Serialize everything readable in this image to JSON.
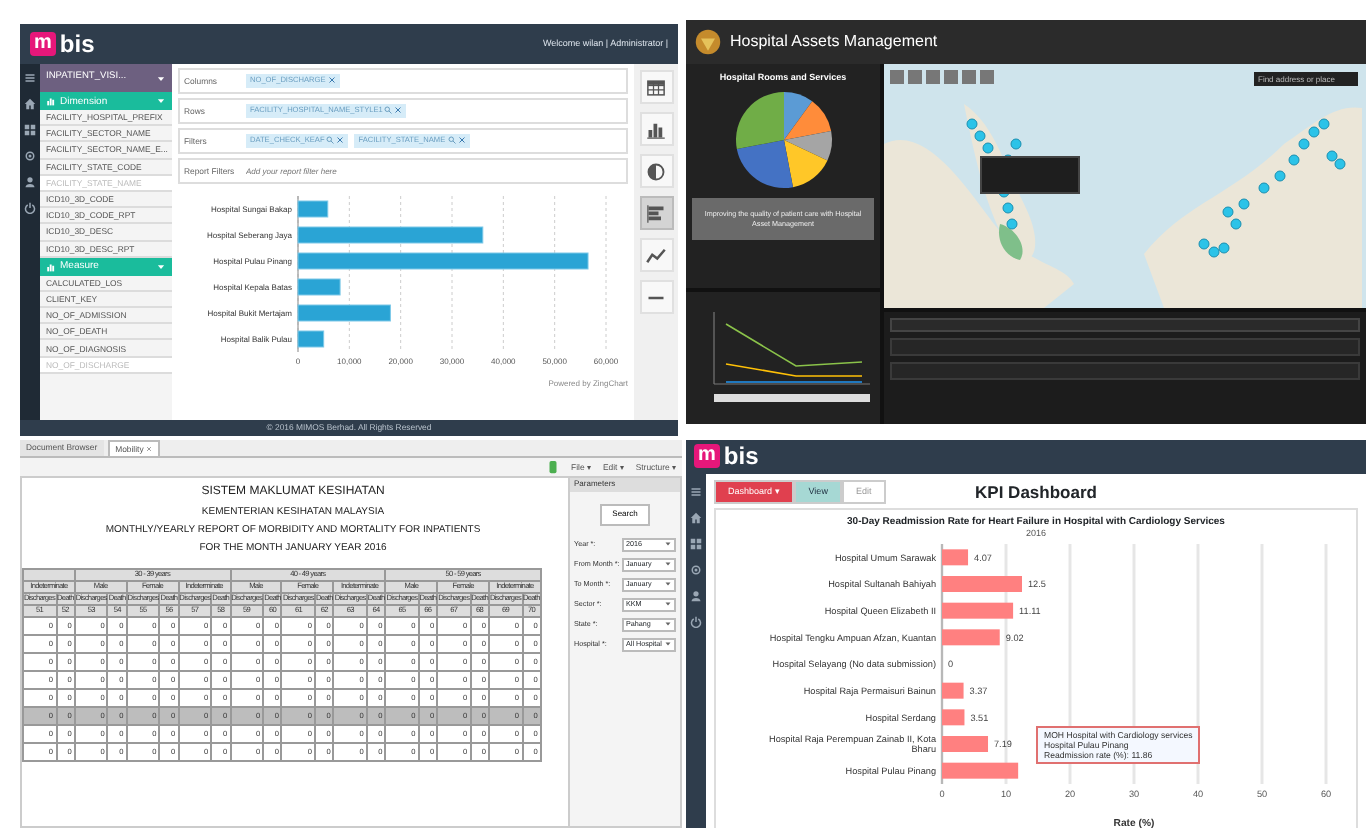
{
  "dashboard_builder": {
    "logo": {
      "mark": "m",
      "text": "bis"
    },
    "welcome": "Welcome wilan | Administrator |",
    "cube_select": "INPATIENT_VISI...",
    "field_groups": [
      {
        "title": "Dimension",
        "expanded": true,
        "fields": [
          {
            "label": "FACILITY_HOSPITAL_PREFIX",
            "disabled": false
          },
          {
            "label": "FACILITY_SECTOR_NAME",
            "disabled": false
          },
          {
            "label": "FACILITY_SECTOR_NAME_E...",
            "disabled": false
          },
          {
            "label": "FACILITY_STATE_CODE",
            "disabled": false
          },
          {
            "label": "FACILITY_STATE_NAME",
            "disabled": true
          },
          {
            "label": "ICD10_3D_CODE",
            "disabled": false
          },
          {
            "label": "ICD10_3D_CODE_RPT",
            "disabled": false
          },
          {
            "label": "ICD10_3D_DESC",
            "disabled": false
          },
          {
            "label": "ICD10_3D_DESC_RPT",
            "disabled": false
          }
        ]
      },
      {
        "title": "Measure",
        "expanded": true,
        "fields": [
          {
            "label": "CALCULATED_LOS",
            "disabled": false
          },
          {
            "label": "CLIENT_KEY",
            "disabled": false
          },
          {
            "label": "NO_OF_ADMISSION",
            "disabled": false
          },
          {
            "label": "NO_OF_DEATH",
            "disabled": false
          },
          {
            "label": "NO_OF_DIAGNOSIS",
            "disabled": false
          },
          {
            "label": "NO_OF_DISCHARGE",
            "disabled": true
          }
        ]
      }
    ],
    "shelves": [
      {
        "label": "Columns",
        "chips": [
          {
            "text": "NO_OF_DISCHARGE",
            "filterable": false
          }
        ]
      },
      {
        "label": "Rows",
        "chips": [
          {
            "text": "FACILITY_HOSPITAL_NAME_STYLE1",
            "filterable": true
          }
        ]
      },
      {
        "label": "Filters",
        "chips": [
          {
            "text": "DATE_CHECK_KEAF",
            "filterable": true
          },
          {
            "text": "FACILITY_STATE_NAME",
            "filterable": true
          }
        ]
      },
      {
        "label": "Report Filters",
        "placeholder": "Add your report filter here"
      }
    ],
    "chart_types": [
      {
        "kind": "table",
        "selected": false
      },
      {
        "kind": "bar",
        "selected": false
      },
      {
        "kind": "pie",
        "selected": false
      },
      {
        "kind": "hbar",
        "selected": true
      },
      {
        "kind": "line",
        "selected": false
      },
      {
        "kind": "minus",
        "selected": false
      }
    ],
    "chart_data": {
      "type": "bar",
      "orientation": "horizontal",
      "grid": true,
      "categories": [
        "Hospital Sungai Bakap",
        "Hospital Seberang Jaya",
        "Hospital Pulau Pinang",
        "Hospital Kepala Batas",
        "Hospital Bukit Mertajam",
        "Hospital Balik Pulau"
      ],
      "values": [
        5800,
        36000,
        56500,
        8200,
        18000,
        5000
      ],
      "xlim": [
        0,
        60000
      ],
      "xticks": [
        {
          "value": 0,
          "label": "0"
        },
        {
          "value": 10000,
          "label": "10,000"
        },
        {
          "value": 20000,
          "label": "20,000"
        },
        {
          "value": 30000,
          "label": "30,000"
        },
        {
          "value": 40000,
          "label": "40,000"
        },
        {
          "value": 50000,
          "label": "50,000"
        },
        {
          "value": 60000,
          "label": "60,000"
        }
      ]
    },
    "credit": "Powered by ZingChart",
    "footer": "© 2016 MIMOS Berhad. All Rights Reserved"
  },
  "asset_map": {
    "title": "Hospital Assets Management",
    "pie_title": "Hospital Rooms and Services",
    "banner": "Improving the quality of patient care with Hospital Asset Management",
    "search": {
      "placeholder": "Find address or place"
    }
  },
  "report_viewer": {
    "tabs": [
      {
        "label": "Document Browser",
        "selected": false,
        "closable": false
      },
      {
        "label": "Mobility",
        "selected": true,
        "closable": true
      }
    ],
    "menus": [
      "File ▾",
      "Edit ▾",
      "Structure ▾"
    ],
    "title_lines": [
      "SISTEM MAKLUMAT KESIHATAN",
      "KEMENTERIAN KESIHATAN MALAYSIA",
      "MONTHLY/YEARLY REPORT OF MORBIDITY AND MORTALITY FOR INPATIENTS",
      "FOR THE MONTH JANUARY YEAR 2016"
    ],
    "age_groups": [
      {
        "sexes": [
          "Indeterminate"
        ]
      },
      {
        "label": "30 - 39 years",
        "sexes": [
          "Male",
          "Female",
          "Indeterminate"
        ]
      },
      {
        "label": "40 - 49 years",
        "sexes": [
          "Male",
          "Female",
          "Indeterminate"
        ]
      },
      {
        "label": "50 - 59 years",
        "sexes": [
          "Male",
          "Female",
          "Indeterminate"
        ]
      }
    ],
    "measures": [
      "Discharges",
      "Death",
      "Discharges",
      "Death",
      "Discharges",
      "Death",
      "Discharges",
      "Death",
      "Discharges",
      "Death",
      "Discharges",
      "Death",
      "Discharges",
      "Death",
      "Discharges",
      "Death",
      "Discharges",
      "Death",
      "Discharges",
      "Death"
    ],
    "column_numbers": [
      "51",
      "52",
      "53",
      "54",
      "55",
      "56",
      "57",
      "58",
      "59",
      "60",
      "61",
      "62",
      "63",
      "64",
      "65",
      "66",
      "67",
      "68",
      "69",
      "70"
    ],
    "rows": [
      {
        "kind": "data",
        "cells": [
          "0",
          "0",
          "0",
          "0",
          "0",
          "0",
          "0",
          "0",
          "0",
          "0",
          "0",
          "0",
          "0",
          "0",
          "0",
          "0",
          "0",
          "0",
          "0",
          "0"
        ]
      },
      {
        "kind": "data",
        "cells": [
          "0",
          "0",
          "0",
          "0",
          "0",
          "0",
          "0",
          "0",
          "0",
          "0",
          "0",
          "0",
          "0",
          "0",
          "0",
          "0",
          "0",
          "0",
          "0",
          "0"
        ]
      },
      {
        "kind": "data",
        "cells": [
          "0",
          "0",
          "0",
          "0",
          "0",
          "0",
          "0",
          "0",
          "0",
          "0",
          "0",
          "0",
          "0",
          "0",
          "0",
          "0",
          "0",
          "0",
          "0",
          "0"
        ]
      },
      {
        "kind": "data",
        "cells": [
          "0",
          "0",
          "0",
          "0",
          "0",
          "0",
          "0",
          "0",
          "0",
          "0",
          "0",
          "0",
          "0",
          "0",
          "0",
          "0",
          "0",
          "0",
          "0",
          "0"
        ]
      },
      {
        "kind": "data",
        "cells": [
          "0",
          "0",
          "0",
          "0",
          "0",
          "0",
          "0",
          "0",
          "0",
          "0",
          "0",
          "0",
          "0",
          "0",
          "0",
          "0",
          "0",
          "0",
          "0",
          "0"
        ]
      },
      {
        "kind": "total",
        "cells": [
          "0",
          "0",
          "0",
          "0",
          "0",
          "0",
          "0",
          "0",
          "0",
          "0",
          "0",
          "0",
          "0",
          "0",
          "0",
          "0",
          "0",
          "0",
          "0",
          "0"
        ]
      },
      {
        "kind": "data",
        "cells": [
          "0",
          "0",
          "0",
          "0",
          "0",
          "0",
          "0",
          "0",
          "0",
          "0",
          "0",
          "0",
          "0",
          "0",
          "0",
          "0",
          "0",
          "0",
          "0",
          "0"
        ]
      },
      {
        "kind": "data",
        "cells": [
          "0",
          "0",
          "0",
          "0",
          "0",
          "0",
          "0",
          "0",
          "0",
          "0",
          "0",
          "0",
          "0",
          "0",
          "0",
          "0",
          "0",
          "0",
          "0",
          "0"
        ]
      }
    ],
    "parameters": {
      "title": "Parameters",
      "button": "Search",
      "fields": [
        {
          "label": "Year *:",
          "value": "2016"
        },
        {
          "label": "From Month *:",
          "value": "January"
        },
        {
          "label": "To Month *:",
          "value": "January"
        },
        {
          "label": "Sector *:",
          "value": "KKM"
        },
        {
          "label": "State *:",
          "value": "Pahang"
        },
        {
          "label": "Hospital *:",
          "value": "All Hospital"
        }
      ]
    }
  },
  "kpi_dashboard": {
    "logo": {
      "mark": "m",
      "text": "bis"
    },
    "buttons": [
      {
        "label": "Dashboard ▾",
        "kind": "dropdown"
      },
      {
        "label": "View",
        "kind": "view"
      },
      {
        "label": "Edit",
        "kind": "edit"
      }
    ],
    "title": "KPI Dashboard",
    "subtitle": "2016",
    "chart_data": {
      "type": "bar",
      "orientation": "horizontal",
      "grid": true,
      "title": "30-Day Readmission Rate for Heart Failure in Hospital with Cardiology Services",
      "xlabel": "Rate (%)",
      "categories": [
        "Hospital Umum Sarawak",
        "Hospital Sultanah Bahiyah",
        "Hospital Queen Elizabeth II",
        "Hospital Tengku Ampuan Afzan, Kuantan",
        "Hospital Selayang (No data submission)",
        "Hospital Raja Permaisuri Bainun",
        "Hospital Serdang",
        "Hospital Raja Perempuan Zainab II, Kota Bharu",
        "Hospital Pulau Pinang"
      ],
      "values": [
        4.07,
        12.5,
        11.11,
        9.02,
        0,
        3.37,
        3.51,
        7.19,
        11.9
      ],
      "xlim": [
        0,
        60
      ],
      "xticks": [
        0,
        10,
        20,
        30,
        40,
        50,
        60
      ],
      "value_labels": [
        "4.07",
        "12.5",
        "11.11",
        "9.02",
        "0",
        "3.37",
        "3.51",
        "7.19",
        null
      ]
    },
    "tooltip": [
      "MOH Hospital with Cardiology services",
      "Hospital Pulau Pinang",
      "Readmission rate (%): 11.86"
    ]
  }
}
